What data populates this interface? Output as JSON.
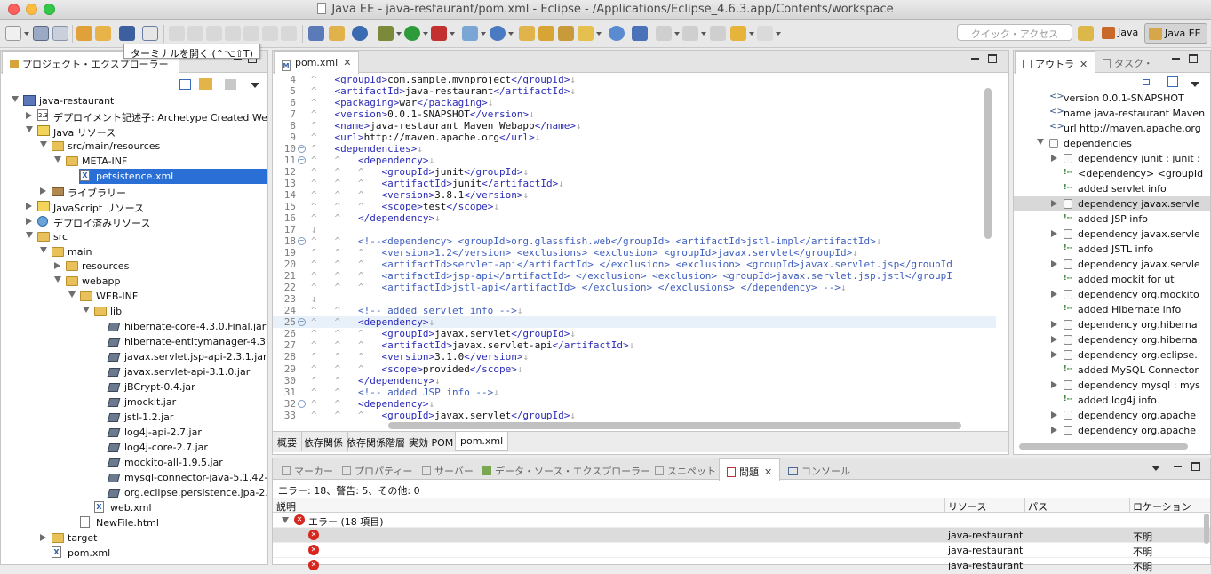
{
  "window": {
    "title": "Java EE - java-restaurant/pom.xml - Eclipse - /Applications/Eclipse_4.6.3.app/Contents/workspace"
  },
  "toolbar": {
    "quick_access_placeholder": "クイック・アクセス",
    "tooltip": "ターミナルを開く (^⌥⇧T)",
    "perspectives": [
      "Java",
      "Java EE"
    ]
  },
  "project_explorer": {
    "tab_label": "プロジェクト・エクスプローラー",
    "tree": [
      {
        "label": "java-restaurant",
        "icon": "project-icon",
        "expanded": true
      },
      {
        "label": "デプロイメント記述子: Archetype Created Web A",
        "icon": "deployment-descriptor-icon",
        "expanded": false
      },
      {
        "label": "Java リソース",
        "icon": "java-resources-icon",
        "expanded": true
      },
      {
        "label": "src/main/resources",
        "icon": "package-folder-icon",
        "expanded": true
      },
      {
        "label": "META-INF",
        "icon": "folder-icon",
        "expanded": true
      },
      {
        "label": "petsistence.xml",
        "icon": "xml-file-icon",
        "selected": true
      },
      {
        "label": "ライブラリー",
        "icon": "library-icon",
        "expanded": false
      },
      {
        "label": "JavaScript リソース",
        "icon": "javascript-resources-icon",
        "expanded": false
      },
      {
        "label": "デプロイ済みリソース",
        "icon": "deployed-resources-icon",
        "expanded": false
      },
      {
        "label": "src",
        "icon": "folder-icon",
        "expanded": true
      },
      {
        "label": "main",
        "icon": "folder-icon",
        "expanded": true
      },
      {
        "label": "resources",
        "icon": "folder-icon",
        "expanded": false
      },
      {
        "label": "webapp",
        "icon": "folder-icon",
        "expanded": true
      },
      {
        "label": "WEB-INF",
        "icon": "folder-icon",
        "expanded": true
      },
      {
        "label": "lib",
        "icon": "folder-icon",
        "expanded": true
      },
      {
        "label": "hibernate-core-4.3.0.Final.jar",
        "icon": "jar-icon"
      },
      {
        "label": "hibernate-entitymanager-4.3.0",
        "icon": "jar-icon"
      },
      {
        "label": "javax.servlet.jsp-api-2.3.1.jar",
        "icon": "jar-icon"
      },
      {
        "label": "javax.servlet-api-3.1.0.jar",
        "icon": "jar-icon"
      },
      {
        "label": "jBCrypt-0.4.jar",
        "icon": "jar-icon"
      },
      {
        "label": "jmockit.jar",
        "icon": "jar-icon"
      },
      {
        "label": "jstl-1.2.jar",
        "icon": "jar-icon"
      },
      {
        "label": "log4j-api-2.7.jar",
        "icon": "jar-icon"
      },
      {
        "label": "log4j-core-2.7.jar",
        "icon": "jar-icon"
      },
      {
        "label": "mockito-all-1.9.5.jar",
        "icon": "jar-icon"
      },
      {
        "label": "mysql-connector-java-5.1.42-b",
        "icon": "jar-icon"
      },
      {
        "label": "org.eclipse.persistence.jpa-2.6",
        "icon": "jar-icon"
      },
      {
        "label": "web.xml",
        "icon": "xml-file-icon"
      },
      {
        "label": "NewFile.html",
        "icon": "html-file-icon"
      },
      {
        "label": "target",
        "icon": "folder-icon",
        "expanded": false
      },
      {
        "label": "pom.xml",
        "icon": "xml-file-icon"
      }
    ]
  },
  "editor": {
    "tab_label": "pom.xml",
    "current_line": "25",
    "lines": [
      {
        "n": "4",
        "fold": "",
        "html": "<span class=\"ws\">^   </span>&lt;groupId&gt;<span class=\"tx\">com.sample.mvnproject</span>&lt;/groupId&gt;<span class=\"ws\">↓</span>"
      },
      {
        "n": "5",
        "fold": "",
        "html": "<span class=\"ws\">^   </span>&lt;artifactId&gt;<span class=\"tx\">java-restaurant</span>&lt;/artifactId&gt;<span class=\"ws\">↓</span>"
      },
      {
        "n": "6",
        "fold": "",
        "html": "<span class=\"ws\">^   </span>&lt;packaging&gt;<span class=\"tx\">war</span>&lt;/packaging&gt;<span class=\"ws\">↓</span>"
      },
      {
        "n": "7",
        "fold": "",
        "html": "<span class=\"ws\">^   </span>&lt;version&gt;<span class=\"tx\">0.0.1-SNAPSHOT</span>&lt;/version&gt;<span class=\"ws\">↓</span>"
      },
      {
        "n": "8",
        "fold": "",
        "html": "<span class=\"ws\">^   </span>&lt;name&gt;<span class=\"tx\">java-restaurant Maven Webapp</span>&lt;/name&gt;<span class=\"ws\">↓</span>"
      },
      {
        "n": "9",
        "fold": "",
        "html": "<span class=\"ws\">^   </span>&lt;url&gt;<span class=\"tx\">http://maven.apache.org</span>&lt;/url&gt;<span class=\"ws\">↓</span>"
      },
      {
        "n": "10",
        "fold": "−",
        "html": "<span class=\"ws\">^   </span>&lt;dependencies&gt;<span class=\"ws\">↓</span>"
      },
      {
        "n": "11",
        "fold": "−",
        "html": "<span class=\"ws\">^   ^   </span>&lt;dependency&gt;<span class=\"ws\">↓</span>"
      },
      {
        "n": "12",
        "fold": "",
        "html": "<span class=\"ws\">^   ^   ^   </span>&lt;groupId&gt;<span class=\"tx\">junit</span>&lt;/groupId&gt;<span class=\"ws\">↓</span>"
      },
      {
        "n": "13",
        "fold": "",
        "html": "<span class=\"ws\">^   ^   ^   </span>&lt;artifactId&gt;<span class=\"tx\">junit</span>&lt;/artifactId&gt;<span class=\"ws\">↓</span>"
      },
      {
        "n": "14",
        "fold": "",
        "html": "<span class=\"ws\">^   ^   ^   </span>&lt;version&gt;<span class=\"tx\">3.8.1</span>&lt;/version&gt;<span class=\"ws\">↓</span>"
      },
      {
        "n": "15",
        "fold": "",
        "html": "<span class=\"ws\">^   ^   ^   </span>&lt;scope&gt;<span class=\"tx\">test</span>&lt;/scope&gt;<span class=\"ws\">↓</span>"
      },
      {
        "n": "16",
        "fold": "",
        "html": "<span class=\"ws\">^   ^   </span>&lt;/dependency&gt;<span class=\"ws\">↓</span>"
      },
      {
        "n": "17",
        "fold": "",
        "html": "<span class=\"ws\">↓</span>"
      },
      {
        "n": "18",
        "fold": "−",
        "html": "<span class=\"ws\">^   ^   </span><span class=\"cm\">&lt;!--&lt;dependency&gt; &lt;groupId&gt;org.glassfish.web&lt;/groupId&gt; &lt;artifactId&gt;jstl-impl&lt;/artifactId&gt;</span><span class=\"ws\">↓</span>"
      },
      {
        "n": "19",
        "fold": "",
        "html": "<span class=\"ws\">^   ^   ^   </span><span class=\"cm\">&lt;version&gt;1.2&lt;/version&gt; &lt;exclusions&gt; &lt;exclusion&gt; &lt;groupId&gt;javax.servlet&lt;/groupId&gt;</span><span class=\"ws\">↓</span>"
      },
      {
        "n": "20",
        "fold": "",
        "html": "<span class=\"ws\">^   ^   ^   </span><span class=\"cm\">&lt;artifactId&gt;servlet-api&lt;/artifactId&gt; &lt;/exclusion&gt; &lt;exclusion&gt; &lt;groupId&gt;javax.servlet.jsp&lt;/groupId</span>"
      },
      {
        "n": "21",
        "fold": "",
        "html": "<span class=\"ws\">^   ^   ^   </span><span class=\"cm\">&lt;artifactId&gt;jsp-api&lt;/artifactId&gt; &lt;/exclusion&gt; &lt;exclusion&gt; &lt;groupId&gt;javax.servlet.jsp.jstl&lt;/groupI</span>"
      },
      {
        "n": "22",
        "fold": "",
        "html": "<span class=\"ws\">^   ^   ^   </span><span class=\"cm\">&lt;artifactId&gt;jstl-api&lt;/artifactId&gt; &lt;/exclusion&gt; &lt;/exclusions&gt; &lt;/dependency&gt; --&gt;</span><span class=\"ws\">↓</span>"
      },
      {
        "n": "23",
        "fold": "",
        "html": "<span class=\"ws\">↓</span>"
      },
      {
        "n": "24",
        "fold": "",
        "html": "<span class=\"ws\">^   ^   </span><span class=\"cm\">&lt;!-- added servlet info --&gt;</span><span class=\"ws\">↓</span>"
      },
      {
        "n": "25",
        "fold": "−",
        "html": "<span class=\"ws\">^   ^   </span>&lt;dependency&gt;<span class=\"ws\">↓</span>"
      },
      {
        "n": "26",
        "fold": "",
        "html": "<span class=\"ws\">^   ^   ^   </span>&lt;groupId&gt;<span class=\"tx\">javax.servlet</span>&lt;/groupId&gt;<span class=\"ws\">↓</span>"
      },
      {
        "n": "27",
        "fold": "",
        "html": "<span class=\"ws\">^   ^   ^   </span>&lt;artifactId&gt;<span class=\"tx\">javax.servlet-api</span>&lt;/artifactId&gt;<span class=\"ws\">↓</span>"
      },
      {
        "n": "28",
        "fold": "",
        "html": "<span class=\"ws\">^   ^   ^   </span>&lt;version&gt;<span class=\"tx\">3.1.0</span>&lt;/version&gt;<span class=\"ws\">↓</span>"
      },
      {
        "n": "29",
        "fold": "",
        "html": "<span class=\"ws\">^   ^   ^   </span>&lt;scope&gt;<span class=\"tx\">provided</span>&lt;/scope&gt;<span class=\"ws\">↓</span>"
      },
      {
        "n": "30",
        "fold": "",
        "html": "<span class=\"ws\">^   ^   </span>&lt;/dependency&gt;<span class=\"ws\">↓</span>"
      },
      {
        "n": "31",
        "fold": "",
        "html": "<span class=\"ws\">^   ^   </span><span class=\"cm\">&lt;!-- added JSP info --&gt;</span><span class=\"ws\">↓</span>"
      },
      {
        "n": "32",
        "fold": "−",
        "html": "<span class=\"ws\">^   ^   </span>&lt;dependency&gt;<span class=\"ws\">↓</span>"
      },
      {
        "n": "33",
        "fold": "",
        "html": "<span class=\"ws\">^   ^   ^   </span>&lt;groupId&gt;<span class=\"tx\">javax.servlet</span>&lt;/groupId&gt;<span class=\"ws\">↓</span>"
      }
    ],
    "bottom_tabs": [
      "概要",
      "依存関係",
      "依存関係階層",
      "実効 POM",
      "pom.xml"
    ]
  },
  "outline": {
    "tab_label": "アウトラ",
    "tab2_label": "タスク・",
    "rows": [
      {
        "label": "version  0.0.1-SNAPSHOT",
        "kind": "attr"
      },
      {
        "label": "name  java-restaurant Maven",
        "kind": "attr"
      },
      {
        "label": "url  http://maven.apache.org",
        "kind": "attr"
      },
      {
        "label": "dependencies",
        "kind": "elem",
        "expanded": true
      },
      {
        "label": "dependency  junit : junit :",
        "kind": "elem",
        "expandable": true
      },
      {
        "label": "<dependency> <groupId",
        "kind": "comment"
      },
      {
        "label": "added servlet info",
        "kind": "comment"
      },
      {
        "label": "dependency  javax.servle",
        "kind": "elem",
        "expandable": true,
        "selected": true
      },
      {
        "label": "added JSP info",
        "kind": "comment"
      },
      {
        "label": "dependency  javax.servle",
        "kind": "elem",
        "expandable": true
      },
      {
        "label": "added JSTL info",
        "kind": "comment"
      },
      {
        "label": "dependency  javax.servle",
        "kind": "elem",
        "expandable": true
      },
      {
        "label": "added mockit for ut",
        "kind": "comment"
      },
      {
        "label": "dependency  org.mockito",
        "kind": "elem",
        "expandable": true
      },
      {
        "label": "added Hibernate info",
        "kind": "comment"
      },
      {
        "label": "dependency  org.hiberna",
        "kind": "elem",
        "expandable": true
      },
      {
        "label": "dependency  org.hiberna",
        "kind": "elem",
        "expandable": true
      },
      {
        "label": "dependency  org.eclipse.",
        "kind": "elem",
        "expandable": true
      },
      {
        "label": "added MySQL Connector",
        "kind": "comment"
      },
      {
        "label": "dependency  mysql : mys",
        "kind": "elem",
        "expandable": true
      },
      {
        "label": "added log4j info",
        "kind": "comment"
      },
      {
        "label": "dependency  org.apache",
        "kind": "elem",
        "expandable": true
      },
      {
        "label": "dependency  org.apache",
        "kind": "elem",
        "expandable": true
      }
    ]
  },
  "bottom_panel": {
    "tabs": [
      "マーカー",
      "プロパティー",
      "サーバー",
      "データ・ソース・エクスプローラー",
      "スニペット",
      "問題",
      "コンソール"
    ],
    "active_tab": "問題",
    "summary": "エラー: 18、警告: 5、その他: 0",
    "columns": [
      "説明",
      "リソース",
      "パス",
      "ロケーション"
    ],
    "group_label": "エラー (18 項目)",
    "rows": [
      {
        "description": "",
        "resource": "java-restaurant",
        "path": "",
        "location": "不明"
      },
      {
        "description": "",
        "resource": "java-restaurant",
        "path": "",
        "location": "不明"
      },
      {
        "description": "",
        "resource": "java-restaurant",
        "path": "",
        "location": "不明"
      }
    ]
  },
  "colors": {
    "selection": "#2a6fd6",
    "error": "#d6261e",
    "xml_tag": "#2b2bb8",
    "xml_comment": "#3f5fbf"
  }
}
